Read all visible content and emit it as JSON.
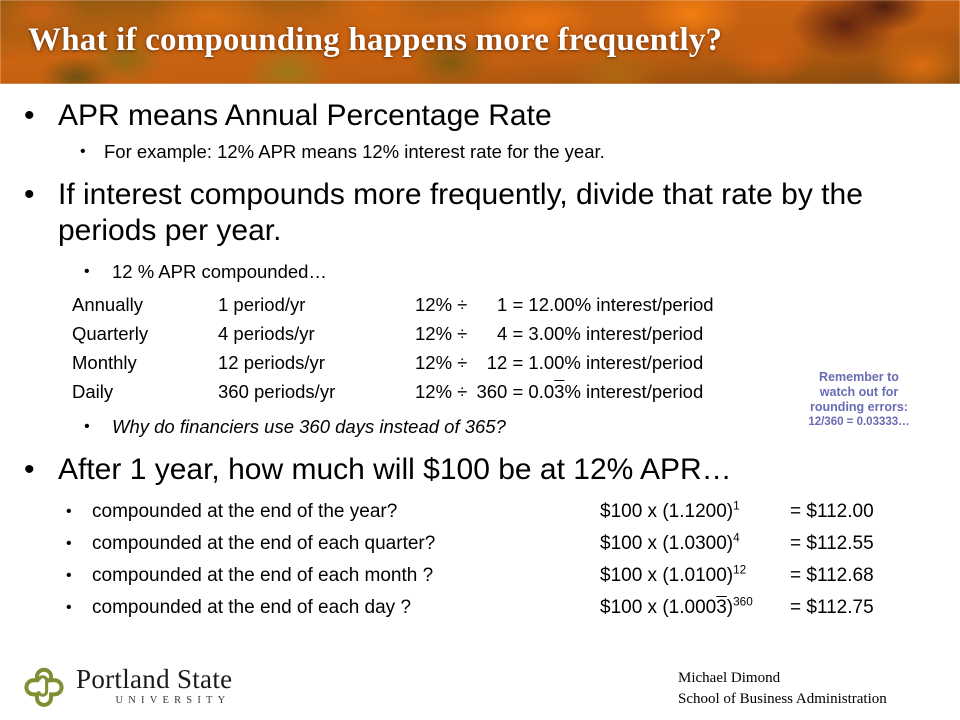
{
  "slide": {
    "title": "What if compounding happens more frequently?"
  },
  "bullets": {
    "apr_heading": "APR means Annual Percentage Rate",
    "apr_example": "For example: 12% APR means 12% interest rate for the year.",
    "compound_heading": "If interest compounds more frequently, divide that rate by the periods per year.",
    "compound_sub": "12 % APR compounded…",
    "why_360": "Why do financiers use 360 days instead of 365?",
    "after_year_heading": "After 1 year, how much will $100 be at 12% APR…"
  },
  "rate_table": {
    "rows": [
      {
        "name": "Annually",
        "periods": "1 period/yr",
        "rate": "12%",
        "divider": "÷",
        "divisor": "1",
        "equals": "=",
        "result": "12.00% interest/period"
      },
      {
        "name": "Quarterly",
        "periods": "4 periods/yr",
        "rate": "12%",
        "divider": "÷",
        "divisor": "4",
        "equals": "=",
        "result": "3.00% interest/period"
      },
      {
        "name": "Monthly",
        "periods": "12 periods/yr",
        "rate": "12%",
        "divider": "÷",
        "divisor": "12",
        "equals": "=",
        "result": "1.00% interest/period"
      },
      {
        "name": "Daily",
        "periods": "360 periods/yr",
        "rate": "12%",
        "divider": "÷",
        "divisor": "360",
        "equals": "=",
        "result_prefix": "0.0",
        "result_repeat": "3",
        "result_suffix": "% interest/period"
      }
    ]
  },
  "note": {
    "line1": "Remember to",
    "line2": "watch out for",
    "line3": "rounding errors:",
    "line4": "12/360 = 0.03333…",
    "color": "#6b6bb4"
  },
  "answers": [
    {
      "question": "compounded at the end of the year?",
      "formula_base": "$100 x (1.1200)",
      "formula_exp": "1",
      "result": "= $112.00"
    },
    {
      "question": "compounded at the end of each quarter?",
      "formula_base": "$100 x (1.0300)",
      "formula_exp": "4",
      "result": "= $112.55"
    },
    {
      "question": "compounded at the end of each month ?",
      "formula_base": "$100 x (1.0100)",
      "formula_exp": "12",
      "result": "= $112.68"
    },
    {
      "question": "compounded at the end of each day ?",
      "formula_base": "$100 x (1.000",
      "formula_repeat": "3",
      "formula_close": ")",
      "formula_exp": "360",
      "result": "= $112.75"
    }
  ],
  "footer": {
    "logo_name": "Portland State",
    "logo_sub": "UNIVERSITY",
    "logo_color": "#7f9034",
    "author": "Michael Dimond",
    "department": "School of Business Administration"
  },
  "icons": {
    "bullet": "•",
    "logo": "psu-quatrefoil-logo"
  }
}
